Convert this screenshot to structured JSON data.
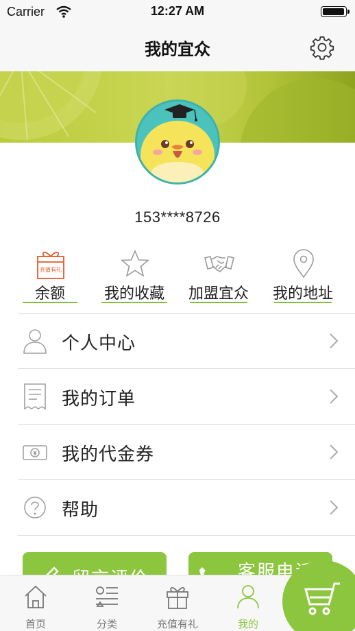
{
  "status_bar": {
    "carrier": "Carrier",
    "time": "12:27 AM"
  },
  "nav": {
    "title": "我的宜众",
    "settings_icon": "gear-icon"
  },
  "profile": {
    "phone": "153****8726"
  },
  "quick_actions": [
    {
      "label": "余额",
      "icon": "gift-icon",
      "icon_text": "充值有礼",
      "color": "#e25b2a"
    },
    {
      "label": "我的收藏",
      "icon": "star-icon"
    },
    {
      "label": "加盟宜众",
      "icon": "handshake-icon"
    },
    {
      "label": "我的地址",
      "icon": "location-pin-icon"
    }
  ],
  "menu": [
    {
      "label": "个人中心",
      "icon": "user-icon"
    },
    {
      "label": "我的订单",
      "icon": "receipt-icon"
    },
    {
      "label": "我的代金券",
      "icon": "voucher-icon"
    },
    {
      "label": "帮助",
      "icon": "help-icon"
    }
  ],
  "buttons": {
    "feedback": {
      "label": "留言评价",
      "icon": "pencil-icon"
    },
    "service": {
      "label": "客服电话",
      "icon": "phone-icon"
    }
  },
  "tabs": [
    {
      "label": "首页",
      "icon": "home-icon"
    },
    {
      "label": "分类",
      "icon": "category-icon"
    },
    {
      "label": "充值有礼",
      "icon": "gift-icon"
    },
    {
      "label": "我的",
      "icon": "user-icon",
      "active": true
    }
  ],
  "cart": {
    "icon": "cart-icon"
  },
  "colors": {
    "accent": "#8cc63f",
    "gift": "#e25b2a",
    "avatar_bg": "#4bc2bc"
  }
}
